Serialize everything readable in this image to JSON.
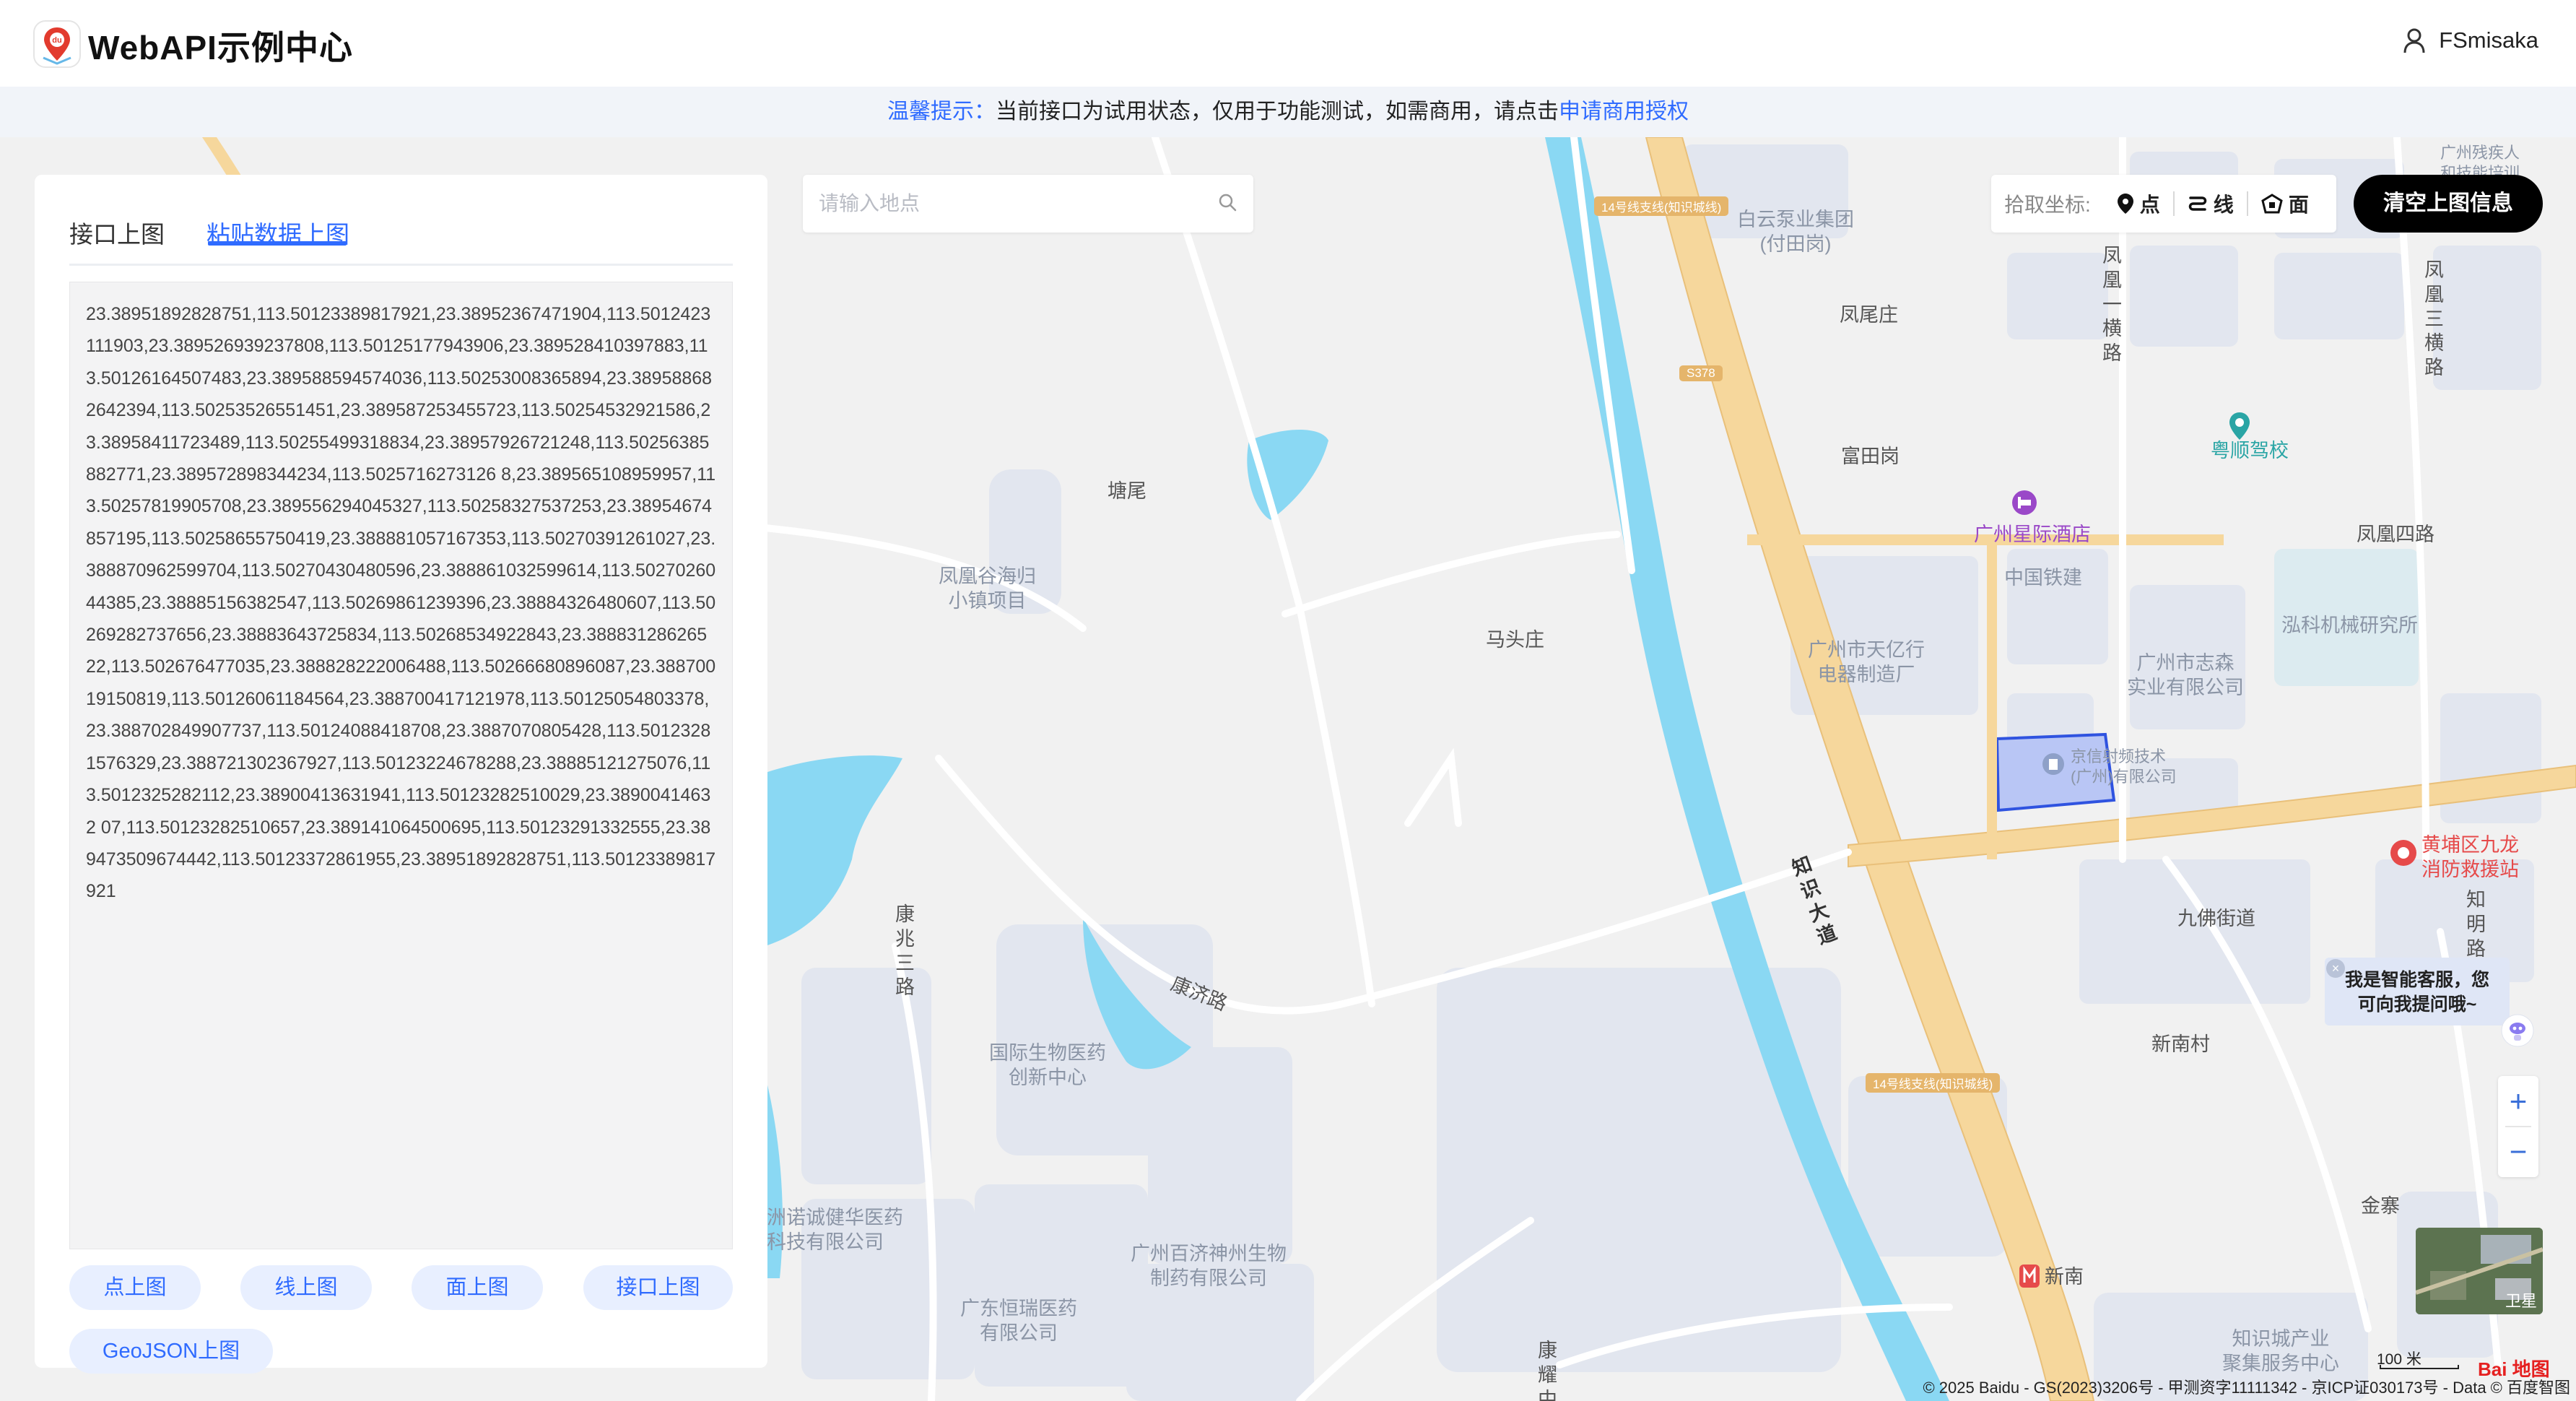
{
  "header": {
    "logo_badge": "du",
    "title": "WebAPI示例中心",
    "user_name": "FSmisaka"
  },
  "notice": {
    "prefix": "温馨提示：",
    "text": "当前接口为试用状态，仅用于功能测试，如需商用，请点击",
    "link": "申请商用授权"
  },
  "panel": {
    "tabs": [
      {
        "label": "接口上图",
        "active": false
      },
      {
        "label": "粘贴数据上图",
        "active": true
      }
    ],
    "textarea_value": "23.38951892828751,113.50123389817921,23.38952367471904,113.5012423111903,23.389526939237808,113.50125177943906,23.389528410397883,113.50126164507483,23.389588594574036,113.50253008365894,23.389588682642394,113.50253526551451,23.389587253455723,113.50254532921586,23.38958411723489,113.50255499318834,23.38957926721248,113.50256385882771,23.389572898344234,113.5025716273126 8,23.389565108959957,113.50257819905708,23.389556294045327,113.50258327537253,23.38954674857195,113.50258655750419,23.388881057167353,113.50270391261027,23.388870962599704,113.50270430480596,23.388861032599614,113.5027026044385,23.38885156382547,113.50269861239396,23.38884326480607,113.50269282737656,23.38883643725834,113.50268534922843,23.38883128626522,113.502676477035,23.388828222006488,113.50266680896087,23.38870019150819,113.50126061184564,23.388700417121978,113.50125054803378,23.388702849907737,113.50124088418708,23.3887070805428,113.50123281576329,23.388721302367927,113.50123224678288,23.38885121275076,113.5012325282112,23.38900413631941,113.50123282510029,23.38900414632 07,113.50123282510657,23.389141064500695,113.50123291332555,23.389473509674442,113.50123372861955,23.38951892828751,113.50123389817921",
    "buttons": [
      "点上图",
      "线上图",
      "面上图",
      "接口上图",
      "GeoJSON上图"
    ]
  },
  "search": {
    "placeholder": "请输入地点"
  },
  "coord_picker": {
    "label": "拾取坐标:",
    "point": "点",
    "line": "线",
    "polygon": "面"
  },
  "clear_button": "清空上图信息",
  "chat_tip": {
    "line1": "我是智能客服，您",
    "line2": "可向我提问哦~",
    "close": "×"
  },
  "zoom": {
    "in": "+",
    "out": "−"
  },
  "satellite_label": "卫星",
  "scale_label": "100 米",
  "baidu_logo": "Bai 地图",
  "copyright": "© 2025 Baidu - GS(2023)3206号 - 甲测资字11111342 - 京ICP证030173号 - Data © 百度智图",
  "map_labels": {
    "baiyun_pump": "白云泵业集团",
    "baiyun_pump_sub": "(付田岗)",
    "fengwei": "凤尾庄",
    "futiangang": "富田岗",
    "fenghuang1": "凤凰一横路",
    "fenghuang3": "凤凰三横路",
    "yueshun": "粤顺驾校",
    "xingji_hotel": "广州星际酒店",
    "fenghuang4": "凤凰四路",
    "crcc": "中国铁建",
    "hongke": "泓科机械研究所",
    "tianyixing": "广州市天亿行",
    "tianyixing_sub": "电器制造厂",
    "zhisen": "广州市志森",
    "zhisen_sub": "实业有限公司",
    "jingxin": "京信射频技术",
    "jingxin_sub": "(广州)有限公司",
    "fire_station": "黄埔区九龙",
    "fire_station_sub": "消防救援站",
    "zhiming": "知明路",
    "jiufo": "九佛街道",
    "xinnan": "新南村",
    "jinzhai": "金寨",
    "xinnan_station": "新南",
    "zhishi_industry": "知识城产业",
    "zhishi_industry_sub": "聚集服务中心",
    "tangwei": "塘尾",
    "fenghuanggu": "凤凰谷海归",
    "fenghuanggu_sub": "小镇项目",
    "matouzhuang": "马头庄",
    "zhishi_road": "知识大道",
    "kangji": "康济路",
    "kangzhao3": "康兆三路",
    "bio_center": "国际生物医药",
    "bio_center_sub": "创新中心",
    "jianhua": "洲诺诚健华医药",
    "jianhua_sub": "科技有限公司",
    "baiji": "广州百济神州生物",
    "baiji_sub": "制药有限公司",
    "hengrui": "广东恒瑞医药",
    "hengrui_sub": "有限公司",
    "kangyao": "康耀中路",
    "road_tag_top": "14号线支线(知识城线)",
    "road_tag_s378": "S378",
    "road_tag_bottom": "14号线支线(知识城线)",
    "disabled": "广州残疾人",
    "disabled_sub": "和技能培训"
  },
  "colors": {
    "accent": "#2f6bff",
    "water": "#8ad8f3",
    "highway": "#f6d79c",
    "block": "#e2e6ef",
    "polygon_fill": "#b9c6f5",
    "polygon_stroke": "#2f53e0"
  }
}
